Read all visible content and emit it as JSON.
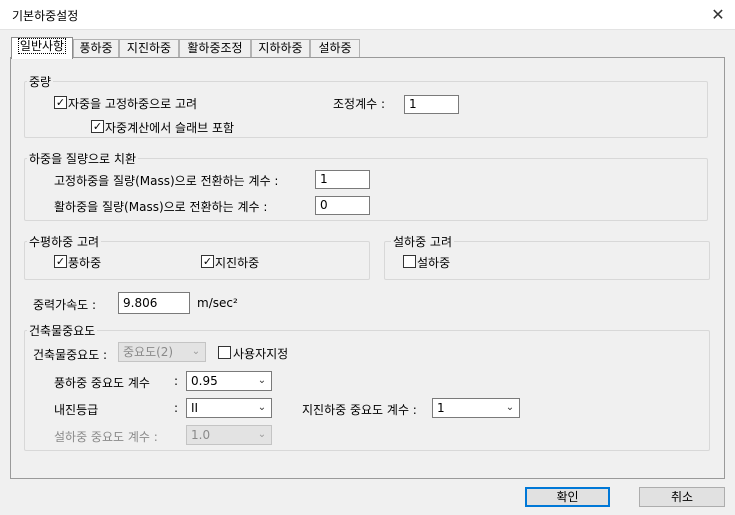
{
  "window": {
    "title": "기본하중설정",
    "close_glyph": "✕"
  },
  "tabs": [
    {
      "label": "일반사항"
    },
    {
      "label": "풍하중"
    },
    {
      "label": "지진하중"
    },
    {
      "label": "활하중조정"
    },
    {
      "label": "지하하중"
    },
    {
      "label": "설하중"
    }
  ],
  "self_weight": {
    "title": "중량",
    "consider_dead_load_label": "자중을 고정하중으로 고려",
    "consider_dead_load_checked": true,
    "include_slab_label": "자중계산에서 슬래브 포함",
    "include_slab_checked": true,
    "factor_label": "조정계수 :",
    "factor_value": "1"
  },
  "mass_conversion": {
    "title": "하중을 질량으로 치환",
    "dead_label": "고정하중을 질량(Mass)으로 전환하는 계수 :",
    "dead_value": "1",
    "live_label": "활하중을 질량(Mass)으로 전환하는 계수 :",
    "live_value": "0"
  },
  "lateral": {
    "title": "수평하중 고려",
    "wind_label": "풍하중",
    "wind_checked": true,
    "seismic_label": "지진하중",
    "seismic_checked": true
  },
  "snow": {
    "title": "설하중 고려",
    "snow_label": "설하중",
    "snow_checked": false
  },
  "gravity": {
    "label": "중력가속도 :",
    "value": "9.806",
    "unit": "m/sec²"
  },
  "importance": {
    "title": "건축물중요도",
    "building_label": "건축물중요도 :",
    "building_value": "중요도(2)",
    "user_defined_label": "사용자지정",
    "user_defined_checked": false,
    "wind_factor_label": "풍하중 중요도 계수",
    "colon": ":",
    "wind_factor_value": "0.95",
    "seismic_grade_label": "내진등급",
    "seismic_grade_value": "II",
    "seismic_factor_label": "지진하중 중요도 계수 :",
    "seismic_factor_value": "1",
    "snow_factor_label": "설하중 중요도 계수 :",
    "snow_factor_value": "1.0"
  },
  "buttons": {
    "ok": "확인",
    "cancel": "취소"
  },
  "icons": {
    "check_glyph": "✓",
    "dropdown_glyph": "⌄"
  }
}
